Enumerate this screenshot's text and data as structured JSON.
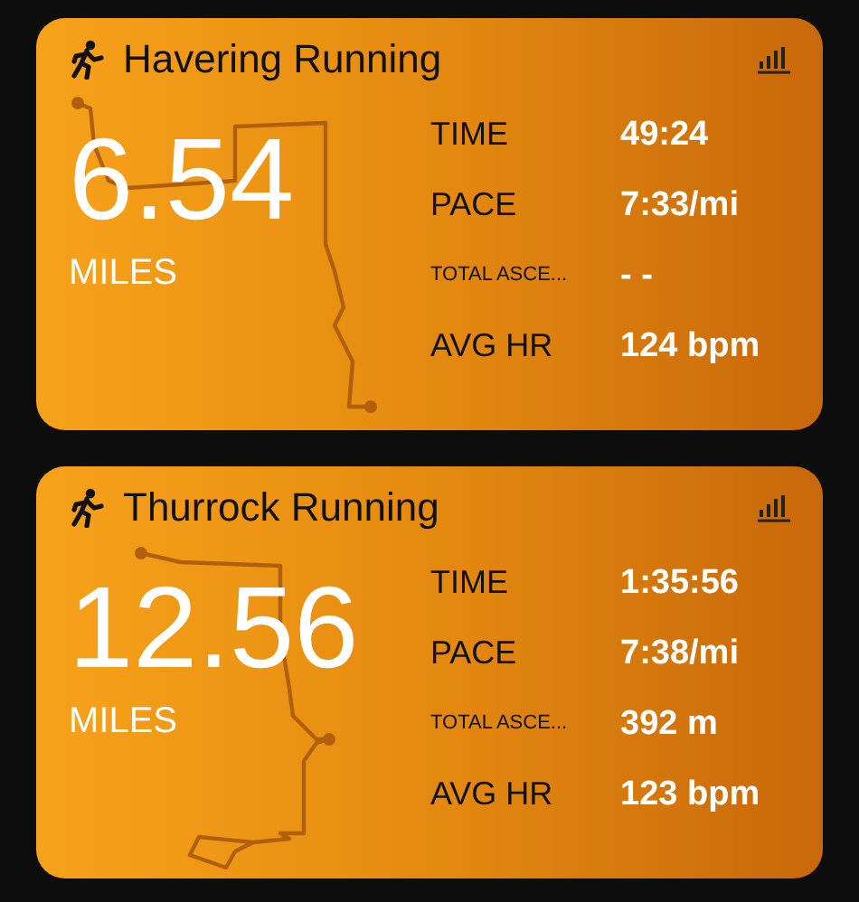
{
  "cards": [
    {
      "title": "Havering Running",
      "distance": "6.54",
      "unit": "MILES",
      "stats": [
        {
          "label": "TIME",
          "value": "49:24"
        },
        {
          "label": "PACE",
          "value": "7:33/mi"
        },
        {
          "label": "TOTAL ASCE...",
          "value": "- -",
          "kind": "small"
        },
        {
          "label": "AVG HR",
          "value": "124 bpm"
        }
      ]
    },
    {
      "title": "Thurrock Running",
      "distance": "12.56",
      "unit": "MILES",
      "stats": [
        {
          "label": "TIME",
          "value": "1:35:56"
        },
        {
          "label": "PACE",
          "value": "7:38/mi"
        },
        {
          "label": "TOTAL ASCE...",
          "value": "392 m",
          "kind": "small"
        },
        {
          "label": "AVG HR",
          "value": "123 bpm"
        }
      ]
    }
  ]
}
